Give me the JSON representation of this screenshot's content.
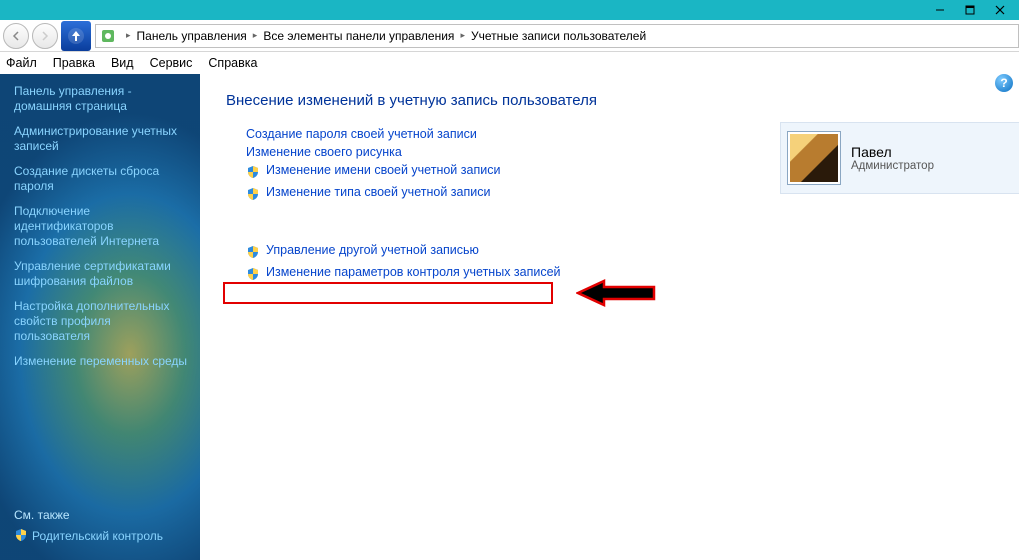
{
  "titlebar": {
    "minimize": "—",
    "maximize": "❐",
    "close": "✕"
  },
  "breadcrumb": {
    "root_sep": "▸",
    "level1": "Панель управления",
    "level2": "Все элементы панели управления",
    "level3": "Учетные записи пользователей"
  },
  "menu": {
    "file": "Файл",
    "edit": "Правка",
    "view": "Вид",
    "tools": "Сервис",
    "help": "Справка"
  },
  "sidebar": {
    "items": [
      "Панель управления - домашняя страница",
      "Администрирование учетных записей",
      "Создание дискеты сброса пароля",
      "Подключение идентификаторов пользователей Интернета",
      "Управление сертификатами шифрования файлов",
      "Настройка дополнительных свойств профиля пользователя",
      "Изменение переменных среды"
    ],
    "see_also_label": "См. также",
    "parental": "Родительский контроль"
  },
  "main": {
    "heading": "Внесение изменений в учетную запись пользователя",
    "tasks_plain": [
      "Создание пароля своей учетной записи",
      "Изменение своего рисунка"
    ],
    "tasks_shield": [
      "Изменение имени своей учетной записи",
      "Изменение типа своей учетной записи"
    ],
    "tasks_shield2": [
      "Управление другой учетной записью",
      "Изменение параметров контроля учетных записей"
    ],
    "account": {
      "name": "Павел",
      "role": "Администратор"
    },
    "help": "?"
  }
}
